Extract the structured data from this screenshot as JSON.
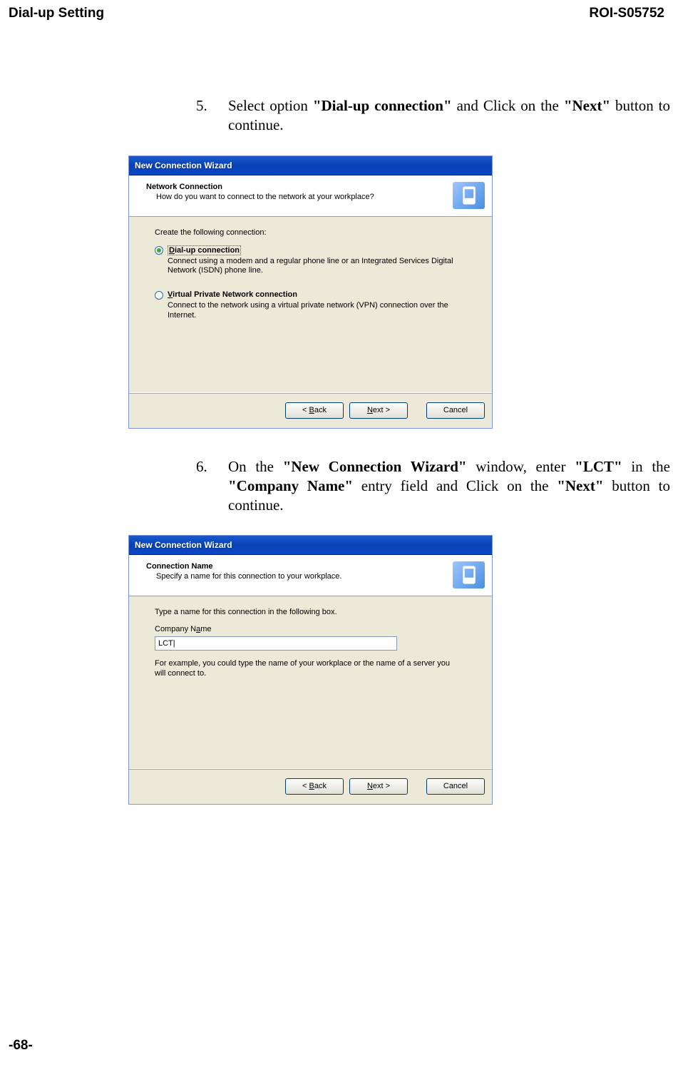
{
  "page_header_left": "Dial-up Setting",
  "page_header_right": "ROI-S05752",
  "page_footer": "-68-",
  "step5": {
    "num": "5.",
    "pre": "Select option ",
    "b1": "\"Dial-up connection\"",
    "mid": " and Click on the ",
    "b2": "\"Next\"",
    "post": " button to continue."
  },
  "step6": {
    "num": "6.",
    "pre": "On the ",
    "b1": "\"New Connection Wizard\"",
    "mid1": " window, enter ",
    "b2": "\"LCT\"",
    "mid2": " in the ",
    "b3": "\"Company Name\"",
    "mid3": " entry field and Click on the ",
    "b4": "\"Next\"",
    "post": " button to continue."
  },
  "dlg1": {
    "title": "New Connection Wizard",
    "banner_title": "Network Connection",
    "banner_sub": "How do you want to connect to the network at your workplace?",
    "lead": "Create the following connection:",
    "opt1_u": "D",
    "opt1_rest": "ial-up connection",
    "opt1_desc": "Connect using a modem and a regular phone line or an Integrated Services Digital Network (ISDN) phone line.",
    "opt2_u": "V",
    "opt2_rest": "irtual Private Network connection",
    "opt2_desc": "Connect to the network using a virtual private network (VPN) connection over the Internet.",
    "back_label_pre": "< ",
    "back_u": "B",
    "back_rest": "ack",
    "next_u": "N",
    "next_rest": "ext >",
    "cancel": "Cancel"
  },
  "dlg2": {
    "title": "New Connection Wizard",
    "banner_title": "Connection Name",
    "banner_sub": "Specify a name for this connection to your workplace.",
    "lead": "Type a name for this connection in the following box.",
    "label_pre": "Company N",
    "label_u": "a",
    "label_post": "me",
    "input_value": "LCT|",
    "helper": "For example, you could type the name of your workplace or the name of a server you will connect to.",
    "back_label_pre": "< ",
    "back_u": "B",
    "back_rest": "ack",
    "next_u": "N",
    "next_rest": "ext >",
    "cancel": "Cancel"
  }
}
